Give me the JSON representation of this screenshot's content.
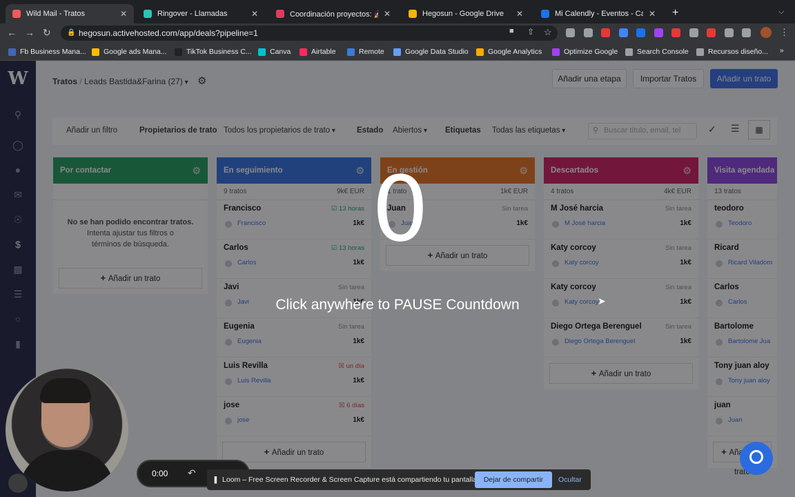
{
  "browser": {
    "tabs": [
      {
        "title": "Wild Mail - Tratos",
        "color": "#f05a5a",
        "active": true
      },
      {
        "title": "Ringover - Llamadas",
        "color": "#29c5b7",
        "active": false
      },
      {
        "title": "Coordinación proyectos: 🚀 Pr",
        "color": "#e8375e",
        "active": false
      },
      {
        "title": "Hegosun - Google Drive",
        "color": "#f4b400",
        "active": false
      },
      {
        "title": "Mi Calendly - Eventos - Calend",
        "color": "#1a73e8",
        "active": false
      }
    ],
    "new_tab": "+",
    "url": "hegosun.activehosted.com/app/deals?pipeline=1",
    "bookmarks": [
      {
        "label": "Fb Business Mana...",
        "color": "#4267b2"
      },
      {
        "label": "Google ads Mana...",
        "color": "#fbbc05"
      },
      {
        "label": "TikTok Business C...",
        "color": "#222222"
      },
      {
        "label": "Canva",
        "color": "#00c4cc"
      },
      {
        "label": "Airtable",
        "color": "#f82b60"
      },
      {
        "label": "Remote",
        "color": "#3a7bd5"
      },
      {
        "label": "Google Data Studio",
        "color": "#669df6"
      },
      {
        "label": "Google Analytics",
        "color": "#f9ab00"
      },
      {
        "label": "Optimize Google",
        "color": "#a142f4"
      },
      {
        "label": "Search Console",
        "color": "#9aa0a6"
      },
      {
        "label": "Recursos diseño...",
        "color": "#9aa0a6"
      }
    ]
  },
  "header": {
    "breadcrumb_root": "Tratos",
    "breadcrumb_sep": "/",
    "pipeline": "Leads Bastida&Farina (27)",
    "add_stage": "Añadir una etapa",
    "import": "Importar Tratos",
    "add_deal": "Añadir un trato"
  },
  "filters": {
    "add_filter": "Añadir un filtro",
    "owners_label": "Propietarios de trato",
    "owners_value": "Todos los propietarios de trato",
    "status_label": "Estado",
    "status_value": "Abiertos",
    "tags_label": "Etiquetas",
    "tags_value": "Todas las etiquetas",
    "search_placeholder": "Buscar título, email, tel"
  },
  "columns": [
    {
      "title": "Por contactar",
      "color": "#1f9a5b",
      "count": "",
      "total": "",
      "empty_title": "No se han podido encontrar tratos.",
      "empty_body": "Intenta ajustar tus filtros o términos de búsqueda.",
      "cards": []
    },
    {
      "title": "En seguimiento",
      "color": "#2f6fe0",
      "count": "9 tratos",
      "total": "9k€ EUR",
      "cards": [
        {
          "name": "Francisco",
          "task": "13 horas",
          "task_state": "ok",
          "owner": "Francisco",
          "value": "1k€"
        },
        {
          "name": "Carlos",
          "task": "13 horas",
          "task_state": "ok",
          "owner": "Carlos",
          "value": "1k€"
        },
        {
          "name": "Javi",
          "task": "Sin tarea",
          "task_state": "none",
          "owner": "Javi",
          "value": "1k€"
        },
        {
          "name": "Eugenia",
          "task": "Sin tarea",
          "task_state": "none",
          "owner": "Eugenia",
          "value": "1k€"
        },
        {
          "name": "Luis Revilla",
          "task": "un día",
          "task_state": "late",
          "owner": "Luis Revilla",
          "value": "1k€"
        },
        {
          "name": "jose",
          "task": "6 días",
          "task_state": "late",
          "owner": "jose",
          "value": "1k€"
        }
      ]
    },
    {
      "title": "En gestión",
      "color": "#e8711d",
      "count": "1 trato",
      "total": "1k€ EUR",
      "cards": [
        {
          "name": "Juan",
          "task": "Sin tarea",
          "task_state": "none",
          "owner": "Juan",
          "value": "1k€"
        }
      ]
    },
    {
      "title": "Descartados",
      "color": "#d3195f",
      "count": "4 tratos",
      "total": "4k€ EUR",
      "cards": [
        {
          "name": "M José harcia",
          "task": "Sin tarea",
          "task_state": "none",
          "owner": "M José harcia",
          "value": "1k€"
        },
        {
          "name": "Katy corcoy",
          "task": "Sin tarea",
          "task_state": "none",
          "owner": "Katy corcoy",
          "value": "1k€"
        },
        {
          "name": "Katy corcoy",
          "task": "Sin tarea",
          "task_state": "none",
          "owner": "Katy corcoy",
          "value": "1k€"
        },
        {
          "name": "Diego Ortega Berenguel",
          "task": "Sin tarea",
          "task_state": "none",
          "owner": "Diego Ortega Berenguel",
          "value": "1k€"
        }
      ]
    },
    {
      "title": "Visita agendada",
      "color": "#8a3ee0",
      "count": "13 tratos",
      "total": "",
      "cards": [
        {
          "name": "teodoro",
          "task": "",
          "task_state": "none",
          "owner": "Teodoro",
          "value": ""
        },
        {
          "name": "Ricard",
          "task": "",
          "task_state": "none",
          "owner": "Ricard Viladom",
          "value": ""
        },
        {
          "name": "Carlos",
          "task": "",
          "task_state": "none",
          "owner": "Carlos",
          "value": ""
        },
        {
          "name": "Bartolome",
          "task": "",
          "task_state": "none",
          "owner": "Bartolome Jua",
          "value": ""
        },
        {
          "name": "Tony juan aloy",
          "task": "",
          "task_state": "none",
          "owner": "Tony juan aloy",
          "value": ""
        },
        {
          "name": "juan",
          "task": "",
          "task_state": "none",
          "owner": "Juan",
          "value": ""
        }
      ]
    }
  ],
  "add_deal_card": "Añadir un trato",
  "overlay": {
    "countdown": "0",
    "message": "Click anywhere to PAUSE Countdown",
    "timer": "0:00",
    "loom_text": "Loom – Free Screen Recorder & Screen Capture está compartiendo tu pantalla.",
    "stop_sharing": "Dejar de compartir",
    "hide": "Ocultar"
  }
}
